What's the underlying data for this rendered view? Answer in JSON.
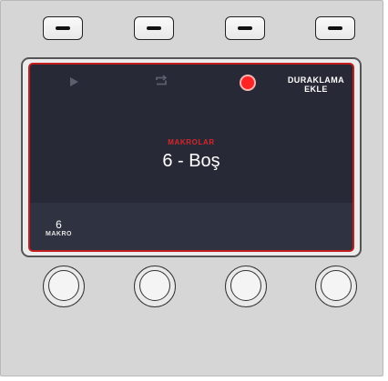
{
  "screen": {
    "add_pause_line1": "DURAKLAMA",
    "add_pause_line2": "EKLE",
    "macros_label": "MAKROLAR",
    "macro_name": "6 - Boş",
    "macro_count": "6",
    "macro_count_label": "MAKRO"
  },
  "icons": {
    "play": "play-icon",
    "loop": "loop-icon",
    "record": "record-icon"
  },
  "colors": {
    "screen_bg": "#272a36",
    "screen_border": "#c21d1d",
    "record": "#ff2424",
    "macros_label": "#d8242a"
  }
}
